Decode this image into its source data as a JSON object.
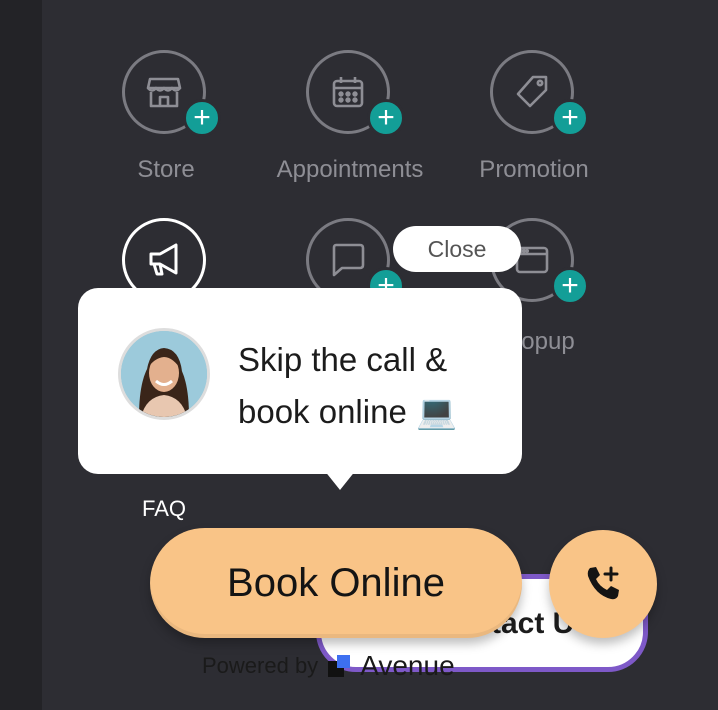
{
  "tiles": [
    {
      "label": "Store",
      "icon": "store-icon"
    },
    {
      "label": "Appointments",
      "icon": "calendar-icon"
    },
    {
      "label": "Promotion",
      "icon": "tag-icon"
    },
    {
      "label": "",
      "icon": "megaphone-icon"
    },
    {
      "label": "",
      "icon": "chat-bubble-icon"
    },
    {
      "label": "opup",
      "icon": "browser-window-icon"
    }
  ],
  "faq_label": "FAQ",
  "popup": {
    "close_label": "Close",
    "message_line1": "Skip the call &",
    "message_line2": "book online 💻"
  },
  "cta": {
    "book_label": "Book Online",
    "contact_label_partial": "tact U",
    "powered_by": "Powered by",
    "brand": "Avenue"
  },
  "colors": {
    "background": "#2d2d33",
    "accent_teal": "#139e97",
    "cta_orange": "#f9c487",
    "contact_border": "#7e59c8"
  }
}
